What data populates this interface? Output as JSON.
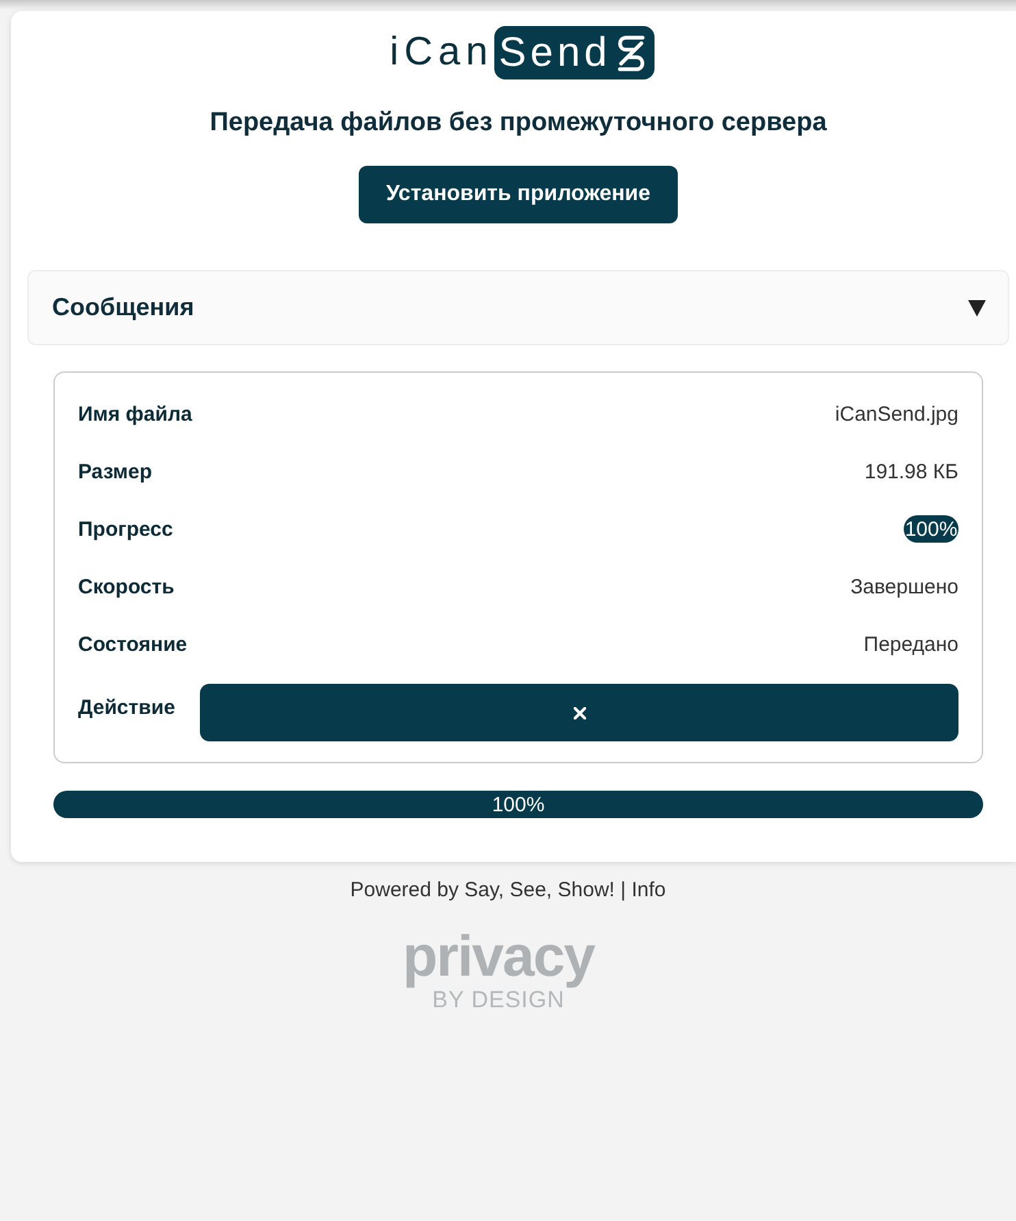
{
  "logo": {
    "plain": "iCan",
    "badge": "Send"
  },
  "subtitle": "Передача файлов без промежуточного сервера",
  "install_button": "Установить приложение",
  "messages_panel": {
    "title": "Сообщения",
    "expanded": false
  },
  "file_card": {
    "rows": [
      {
        "kind": "text",
        "label": "Имя файла",
        "value": "iCanSend.jpg"
      },
      {
        "kind": "text",
        "label": "Размер",
        "value": "191.98 КБ"
      },
      {
        "kind": "progress",
        "label": "Прогресс",
        "level": 1,
        "value": "100%"
      },
      {
        "kind": "text",
        "label": "Скорость",
        "value": "Завершено"
      },
      {
        "kind": "text",
        "label": "Состояние",
        "value": "Передано"
      },
      {
        "kind": "button",
        "label": "Действие"
      }
    ]
  },
  "total_progress": {
    "level": 1,
    "reading": "100%"
  },
  "footer": {
    "credit": "Powered by Say, See, Show! |",
    "link": "Info"
  },
  "privacy_logo": {
    "word": "privacy",
    "tagline": "BY DESIGN"
  }
}
